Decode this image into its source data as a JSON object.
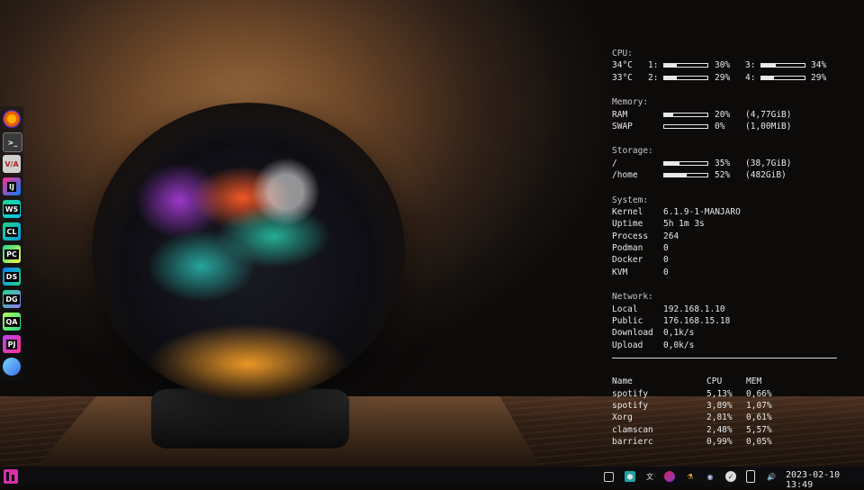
{
  "conky": {
    "cpu": {
      "heading": "CPU:",
      "temps": [
        "34°C",
        "33°C"
      ],
      "cores": [
        {
          "id": "1:",
          "pct": "30%",
          "value": 0.3
        },
        {
          "id": "2:",
          "pct": "29%",
          "value": 0.29
        },
        {
          "id": "3:",
          "pct": "34%",
          "value": 0.34
        },
        {
          "id": "4:",
          "pct": "29%",
          "value": 0.29
        }
      ]
    },
    "memory": {
      "heading": "Memory:",
      "rows": [
        {
          "label": "RAM",
          "pct": "20%",
          "value": 0.2,
          "amount": "(4,77GiB)"
        },
        {
          "label": "SWAP",
          "pct": "0%",
          "value": 0.0,
          "amount": "(1,00MiB)"
        }
      ]
    },
    "storage": {
      "heading": "Storage:",
      "rows": [
        {
          "label": "/",
          "pct": "35%",
          "value": 0.35,
          "amount": "(38,7GiB)"
        },
        {
          "label": "/home",
          "pct": "52%",
          "value": 0.52,
          "amount": "(482GiB)"
        }
      ]
    },
    "system": {
      "heading": "System:",
      "rows": [
        {
          "label": "Kernel",
          "value": "6.1.9-1-MANJARO"
        },
        {
          "label": "Uptime",
          "value": "5h 1m 3s"
        },
        {
          "label": "Process",
          "value": "264"
        },
        {
          "label": "Podman",
          "value": "0"
        },
        {
          "label": "Docker",
          "value": "0"
        },
        {
          "label": "KVM",
          "value": "0"
        }
      ]
    },
    "network": {
      "heading": "Network:",
      "rows": [
        {
          "label": "Local",
          "value": "192.168.1.10"
        },
        {
          "label": "Public",
          "value": "176.168.15.18"
        },
        {
          "label": "Download",
          "value": "0,1k/s"
        },
        {
          "label": "Upload",
          "value": "0,0k/s"
        }
      ]
    },
    "processes": {
      "headers": [
        "Name",
        "CPU",
        "MEM"
      ],
      "rows": [
        [
          "spotify",
          "5,13%",
          "0,66%"
        ],
        [
          "spotify",
          "3,89%",
          "1,07%"
        ],
        [
          "Xorg",
          "2,81%",
          "0,61%"
        ],
        [
          "clamscan",
          "2,48%",
          "5,57%"
        ],
        [
          "barrierc",
          "0,99%",
          "0,05%"
        ]
      ]
    }
  },
  "dock": {
    "items": [
      {
        "name": "firefox-icon",
        "label": "",
        "color": "#e66000"
      },
      {
        "name": "terminal-icon",
        "label": ">_",
        "color": "#3a3a3a"
      },
      {
        "name": "vivaldi-icon",
        "label": "V/A",
        "color": "#d0d0d0"
      },
      {
        "name": "intellij-icon",
        "label": "IJ",
        "color": "#1b1b1b"
      },
      {
        "name": "webstorm-icon",
        "label": "WS",
        "color": "#1b1b1b"
      },
      {
        "name": "clion-icon",
        "label": "CL",
        "color": "#1b1b1b"
      },
      {
        "name": "pycharm-icon",
        "label": "PC",
        "color": "#1b1b1b"
      },
      {
        "name": "dataspell-icon",
        "label": "DS",
        "color": "#1b1b1b"
      },
      {
        "name": "datagrip-icon",
        "label": "DG",
        "color": "#1b1b1b"
      },
      {
        "name": "aqua-icon",
        "label": "QA",
        "color": "#1b1b1b"
      },
      {
        "name": "phpstorm-icon",
        "label": "PJ",
        "color": "#1b1b1b"
      },
      {
        "name": "fleet-icon",
        "label": "",
        "color": "#3aa0e8"
      }
    ]
  },
  "taskbar": {
    "clock": "2023-02-10 13:49",
    "tray": [
      "clipboard-icon",
      "app-icon",
      "translate-icon",
      "kde-connect-icon",
      "flask-icon",
      "discord-icon",
      "update-icon",
      "battery-icon",
      "volume-icon"
    ]
  }
}
